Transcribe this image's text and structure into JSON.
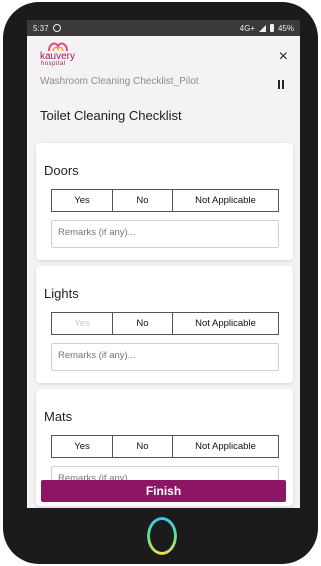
{
  "status_bar": {
    "time": "5:37",
    "network": "4G+",
    "battery": "45%"
  },
  "header": {
    "logo_text": "kauvery",
    "logo_subtext": "hospital",
    "app_title": "Washroom Cleaning Checklist_Pilot",
    "close_label": "×"
  },
  "page_title": "Toilet Cleaning Checklist",
  "checklist": [
    {
      "title": "Doors",
      "options": [
        "Yes",
        "No",
        "Not Applicable"
      ],
      "remarks_placeholder": "Remarks (if any)..."
    },
    {
      "title": "Lights",
      "options": [
        "Yes",
        "No",
        "Not Applicable"
      ],
      "remarks_placeholder": "Remarks (if any)..."
    },
    {
      "title": "Mats",
      "options": [
        "Yes",
        "No",
        "Not Applicable"
      ],
      "remarks_placeholder": "Remarks (if any)..."
    }
  ],
  "footer": {
    "finish_label": "Finish"
  },
  "colors": {
    "brand": "#a0175e",
    "finish_button": "#8e1466"
  }
}
